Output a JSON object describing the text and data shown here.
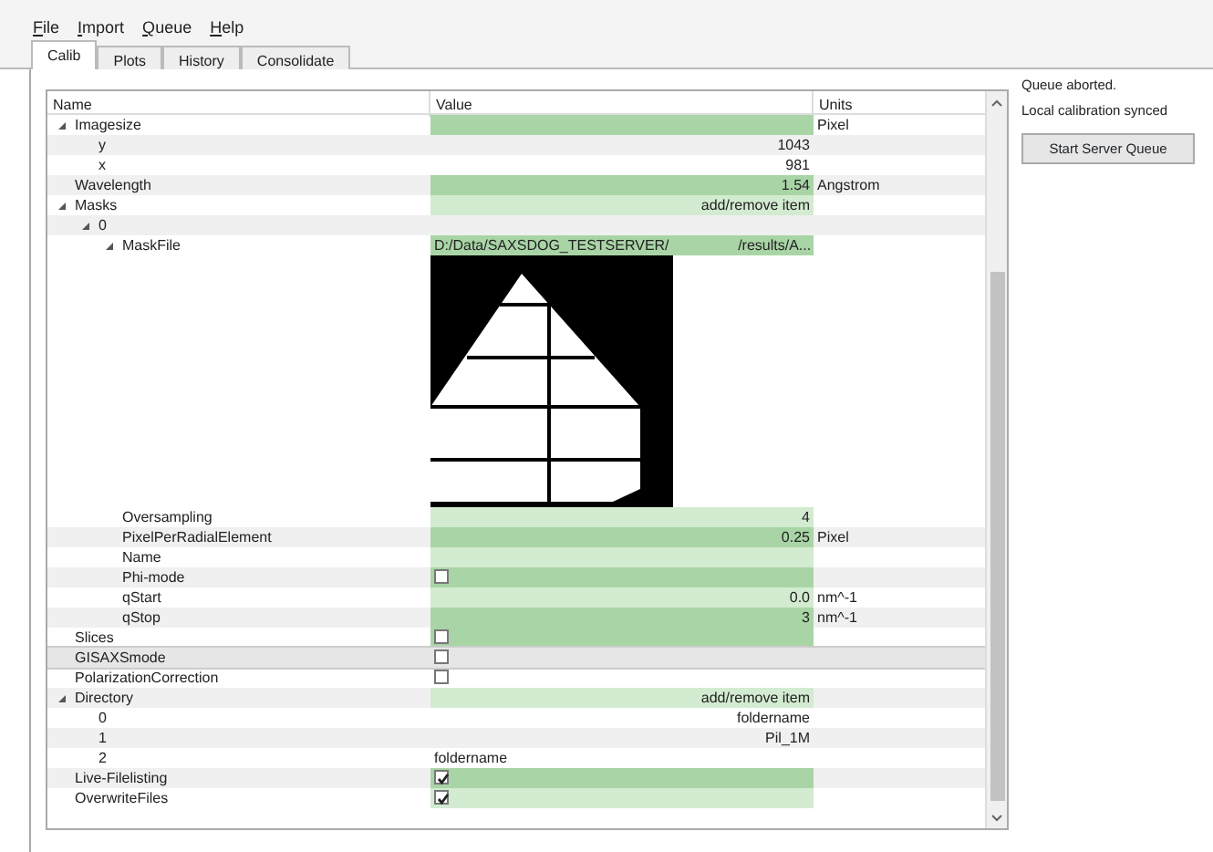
{
  "menu": [
    "File",
    "Import",
    "Queue",
    "Help"
  ],
  "tabs": [
    {
      "label": "Calib",
      "selected": true
    },
    {
      "label": "Plots",
      "selected": false
    },
    {
      "label": "History",
      "selected": false
    },
    {
      "label": "Consolidate",
      "selected": false
    }
  ],
  "tree": {
    "columns": [
      "Name",
      "Value",
      "Units"
    ],
    "rows": [
      {
        "name": "Imagesize",
        "expanded": true,
        "kind": "display",
        "units": "Pixel",
        "color": "#a9d5a6",
        "selected": false,
        "children": [
          {
            "name": "y",
            "kind": "display",
            "value": "1043",
            "selected": false
          },
          {
            "name": "x",
            "kind": "display",
            "value": "981",
            "selected": false
          }
        ]
      },
      {
        "name": "Wavelength",
        "kind": "display",
        "value": "1.54",
        "units": "Angstrom",
        "color": "#a9d5a6",
        "selected": false
      },
      {
        "name": "Masks",
        "expanded": true,
        "kind": "display",
        "value": "add/remove item",
        "color": "#d3ebd0",
        "selected": false,
        "children": [
          {
            "name": "0",
            "expanded": true,
            "kind": "display",
            "selected": false,
            "children": [
              {
                "name": "MaskFile",
                "expanded": true,
                "kind": "editor",
                "value": "D:/Data/SAXSDOG_TESTSERVER/                 /results/A...",
                "color": "#a9d5a6",
                "selected": false,
                "children": [
                  {
                    "kind": "image",
                    "selected": false
                  }
                ]
              },
              {
                "name": "Oversampling",
                "kind": "display",
                "value": "4",
                "color": "#d3ebd0",
                "selected": false
              },
              {
                "name": "PixelPerRadialElement",
                "kind": "display",
                "value": "0.25",
                "units": "Pixel",
                "color": "#a9d5a6",
                "selected": false
              },
              {
                "name": "Name",
                "kind": "display",
                "color": "#d3ebd0",
                "selected": false
              },
              {
                "name": "Phi-mode",
                "kind": "checkbox",
                "checked": false,
                "color": "#a9d5a6",
                "selected": false
              },
              {
                "name": "qStart",
                "kind": "display",
                "value": "0.0",
                "units": "nm^-1",
                "color": "#d3ebd0",
                "selected": false
              },
              {
                "name": "qStop",
                "kind": "display",
                "value": "3",
                "units": "nm^-1",
                "color": "#a9d5a6",
                "selected": false
              }
            ]
          }
        ]
      },
      {
        "name": "Slices",
        "kind": "checkbox",
        "checked": false,
        "color": "#a9d5a6",
        "selected": false
      },
      {
        "name": "GISAXSmode",
        "kind": "checkbox",
        "checked": false,
        "selected": true
      },
      {
        "name": "PolarizationCorrection",
        "kind": "checkbox",
        "checked": false,
        "selected": false
      },
      {
        "name": "Directory",
        "expanded": true,
        "kind": "display",
        "value": "add/remove item",
        "color": "#d3ebd0",
        "selected": false,
        "children": [
          {
            "name": "0",
            "kind": "display",
            "value": "foldername",
            "selected": false
          },
          {
            "name": "1",
            "kind": "display",
            "value": "Pil_1M",
            "selected": false
          },
          {
            "name": "2",
            "kind": "editor",
            "value": "foldername",
            "selected": false
          }
        ]
      },
      {
        "name": "Live-Filelisting",
        "kind": "checkbox",
        "checked": true,
        "color": "#a9d5a6",
        "selected": false
      },
      {
        "name": "OverwriteFiles",
        "kind": "checkbox",
        "checked": true,
        "color": "#d3ebd0",
        "selected": false
      }
    ]
  },
  "status": [
    "Queue aborted.",
    "Local calibration synced"
  ],
  "button": "Start Server Queue"
}
